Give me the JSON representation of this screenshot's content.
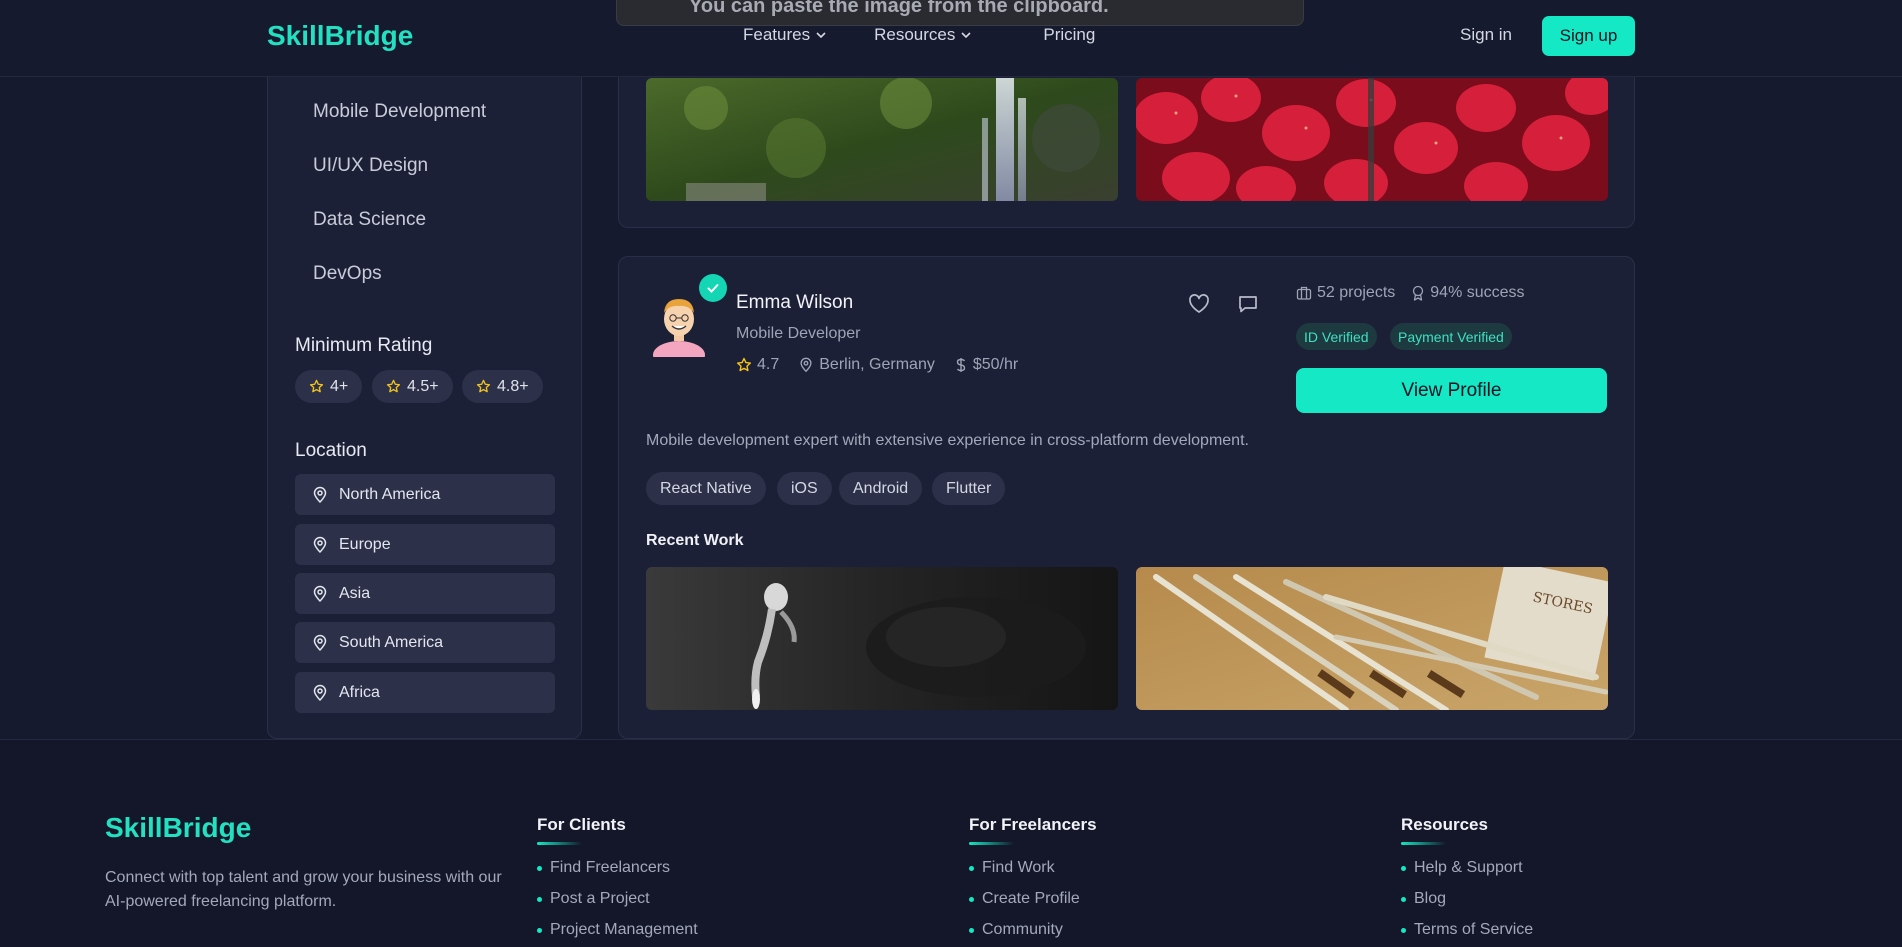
{
  "header": {
    "logo": "SkillBridge",
    "nav": [
      {
        "label": "Features",
        "dropdown": true
      },
      {
        "label": "Resources",
        "dropdown": true
      },
      {
        "label": "Pricing",
        "dropdown": false
      }
    ],
    "sign_in": "Sign in",
    "sign_up": "Sign up",
    "toast": "You can paste the image from the clipboard."
  },
  "sidebar": {
    "categories": [
      "Mobile Development",
      "UI/UX Design",
      "Data Science",
      "DevOps"
    ],
    "rating_title": "Minimum Rating",
    "ratings": [
      "4+",
      "4.5+",
      "4.8+"
    ],
    "location_title": "Location",
    "locations": [
      "North America",
      "Europe",
      "Asia",
      "South America",
      "Africa"
    ]
  },
  "profile": {
    "name": "Emma Wilson",
    "role": "Mobile Developer",
    "rating": "4.7",
    "location": "Berlin, Germany",
    "rate": "$50/hr",
    "projects": "52 projects",
    "success": "94% success",
    "badges": [
      "ID Verified",
      "Payment Verified"
    ],
    "view_profile": "View Profile",
    "description": "Mobile development expert with extensive experience in cross-platform development.",
    "skills": [
      "React Native",
      "iOS",
      "Android",
      "Flutter"
    ],
    "recent_work_title": "Recent Work"
  },
  "footer": {
    "logo": "SkillBridge",
    "description": "Connect with top talent and grow your business with our AI-powered freelancing platform.",
    "columns": [
      {
        "title": "For Clients",
        "links": [
          "Find Freelancers",
          "Post a Project",
          "Project Management"
        ]
      },
      {
        "title": "For Freelancers",
        "links": [
          "Find Work",
          "Create Profile",
          "Community"
        ]
      },
      {
        "title": "Resources",
        "links": [
          "Help & Support",
          "Blog",
          "Terms of Service"
        ]
      }
    ]
  },
  "colors": {
    "accent": "#14e8c4",
    "background": "#161a2e",
    "card": "#1c2036"
  }
}
